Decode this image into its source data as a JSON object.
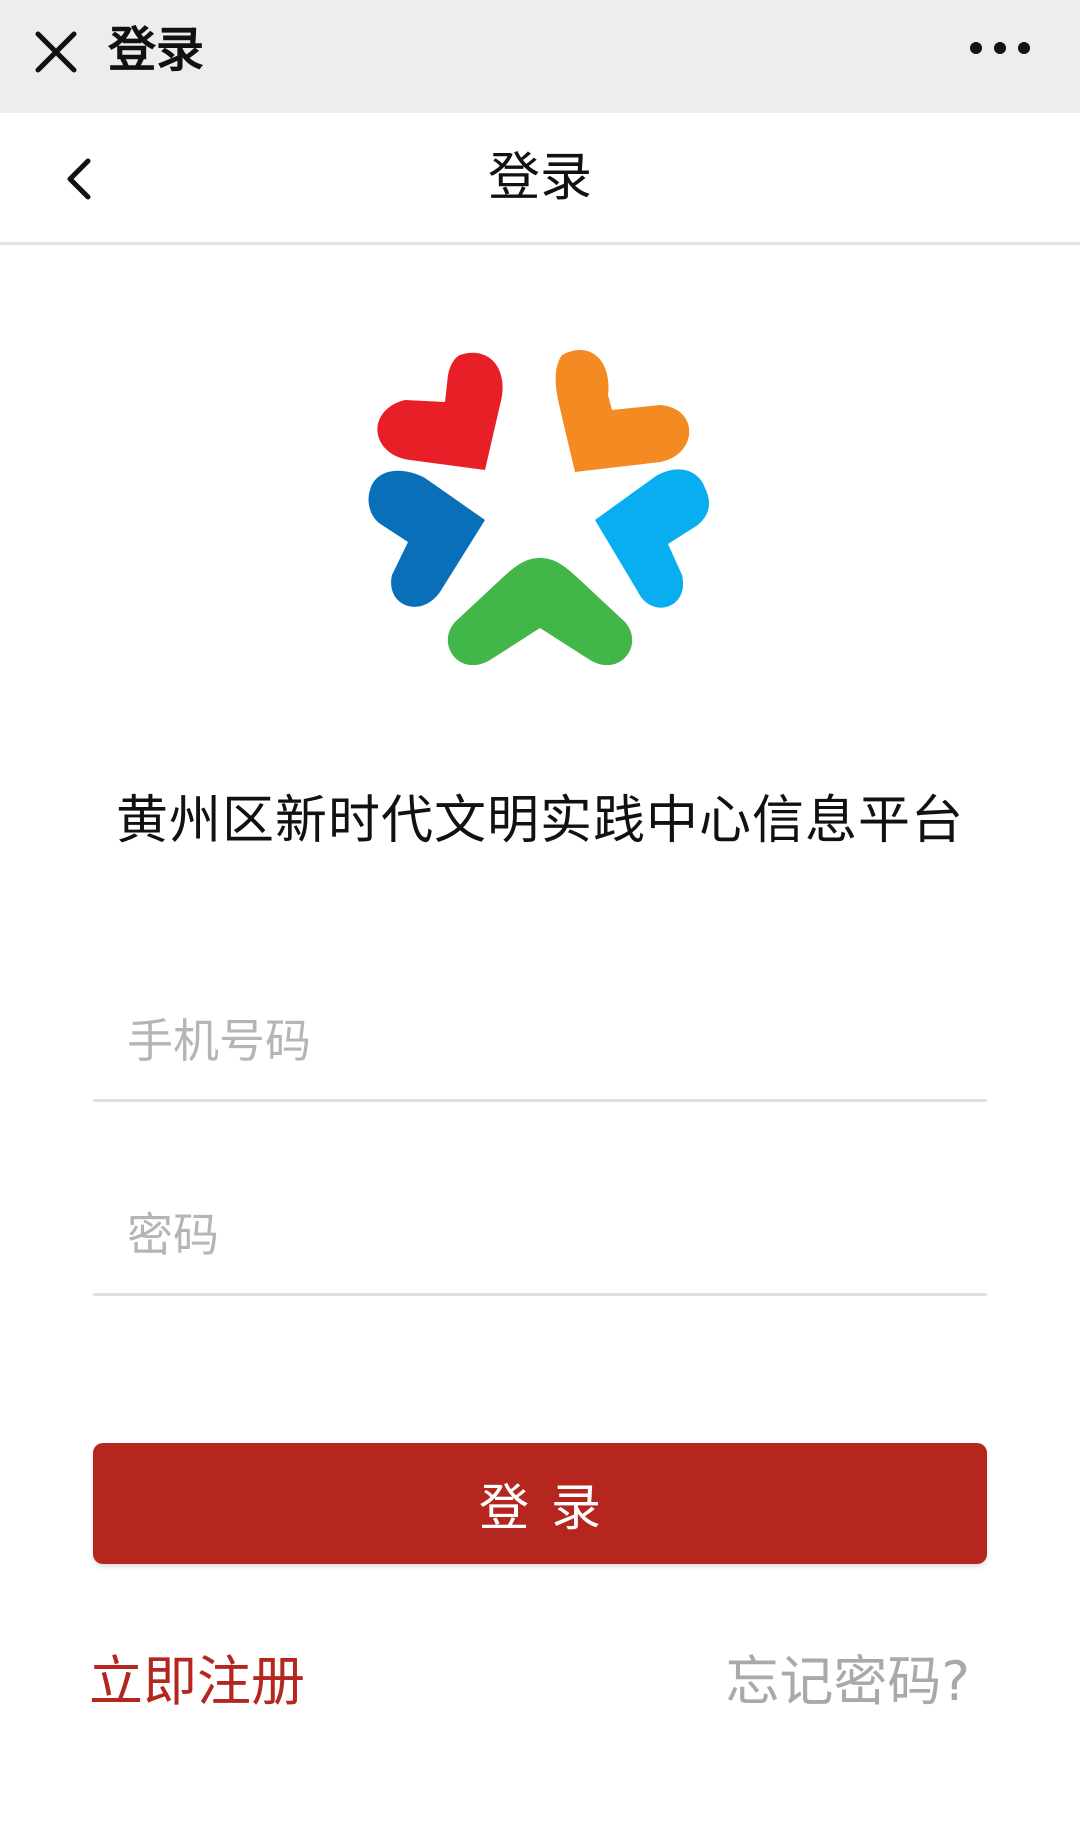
{
  "wechat_bar": {
    "title": "登录",
    "close_icon": "close-icon",
    "more_icon": "more-dots-icon"
  },
  "nav": {
    "title": "登录",
    "back_icon": "chevron-left-icon"
  },
  "logo": {
    "icon": "star-hearts-logo",
    "colors": {
      "red": "#e91f27",
      "orange": "#f38a22",
      "blue": "#0a6fb9",
      "light_blue": "#09aef0",
      "green": "#43b649"
    }
  },
  "app_name": "黄州区新时代文明实践中心信息平台",
  "form": {
    "phone_placeholder": "手机号码",
    "password_placeholder": "密码",
    "login_label": "登录"
  },
  "links": {
    "register": "立即注册",
    "forgot": "忘记密码?"
  },
  "colors": {
    "accent": "#b5261e",
    "top_bar": "#ededed"
  }
}
